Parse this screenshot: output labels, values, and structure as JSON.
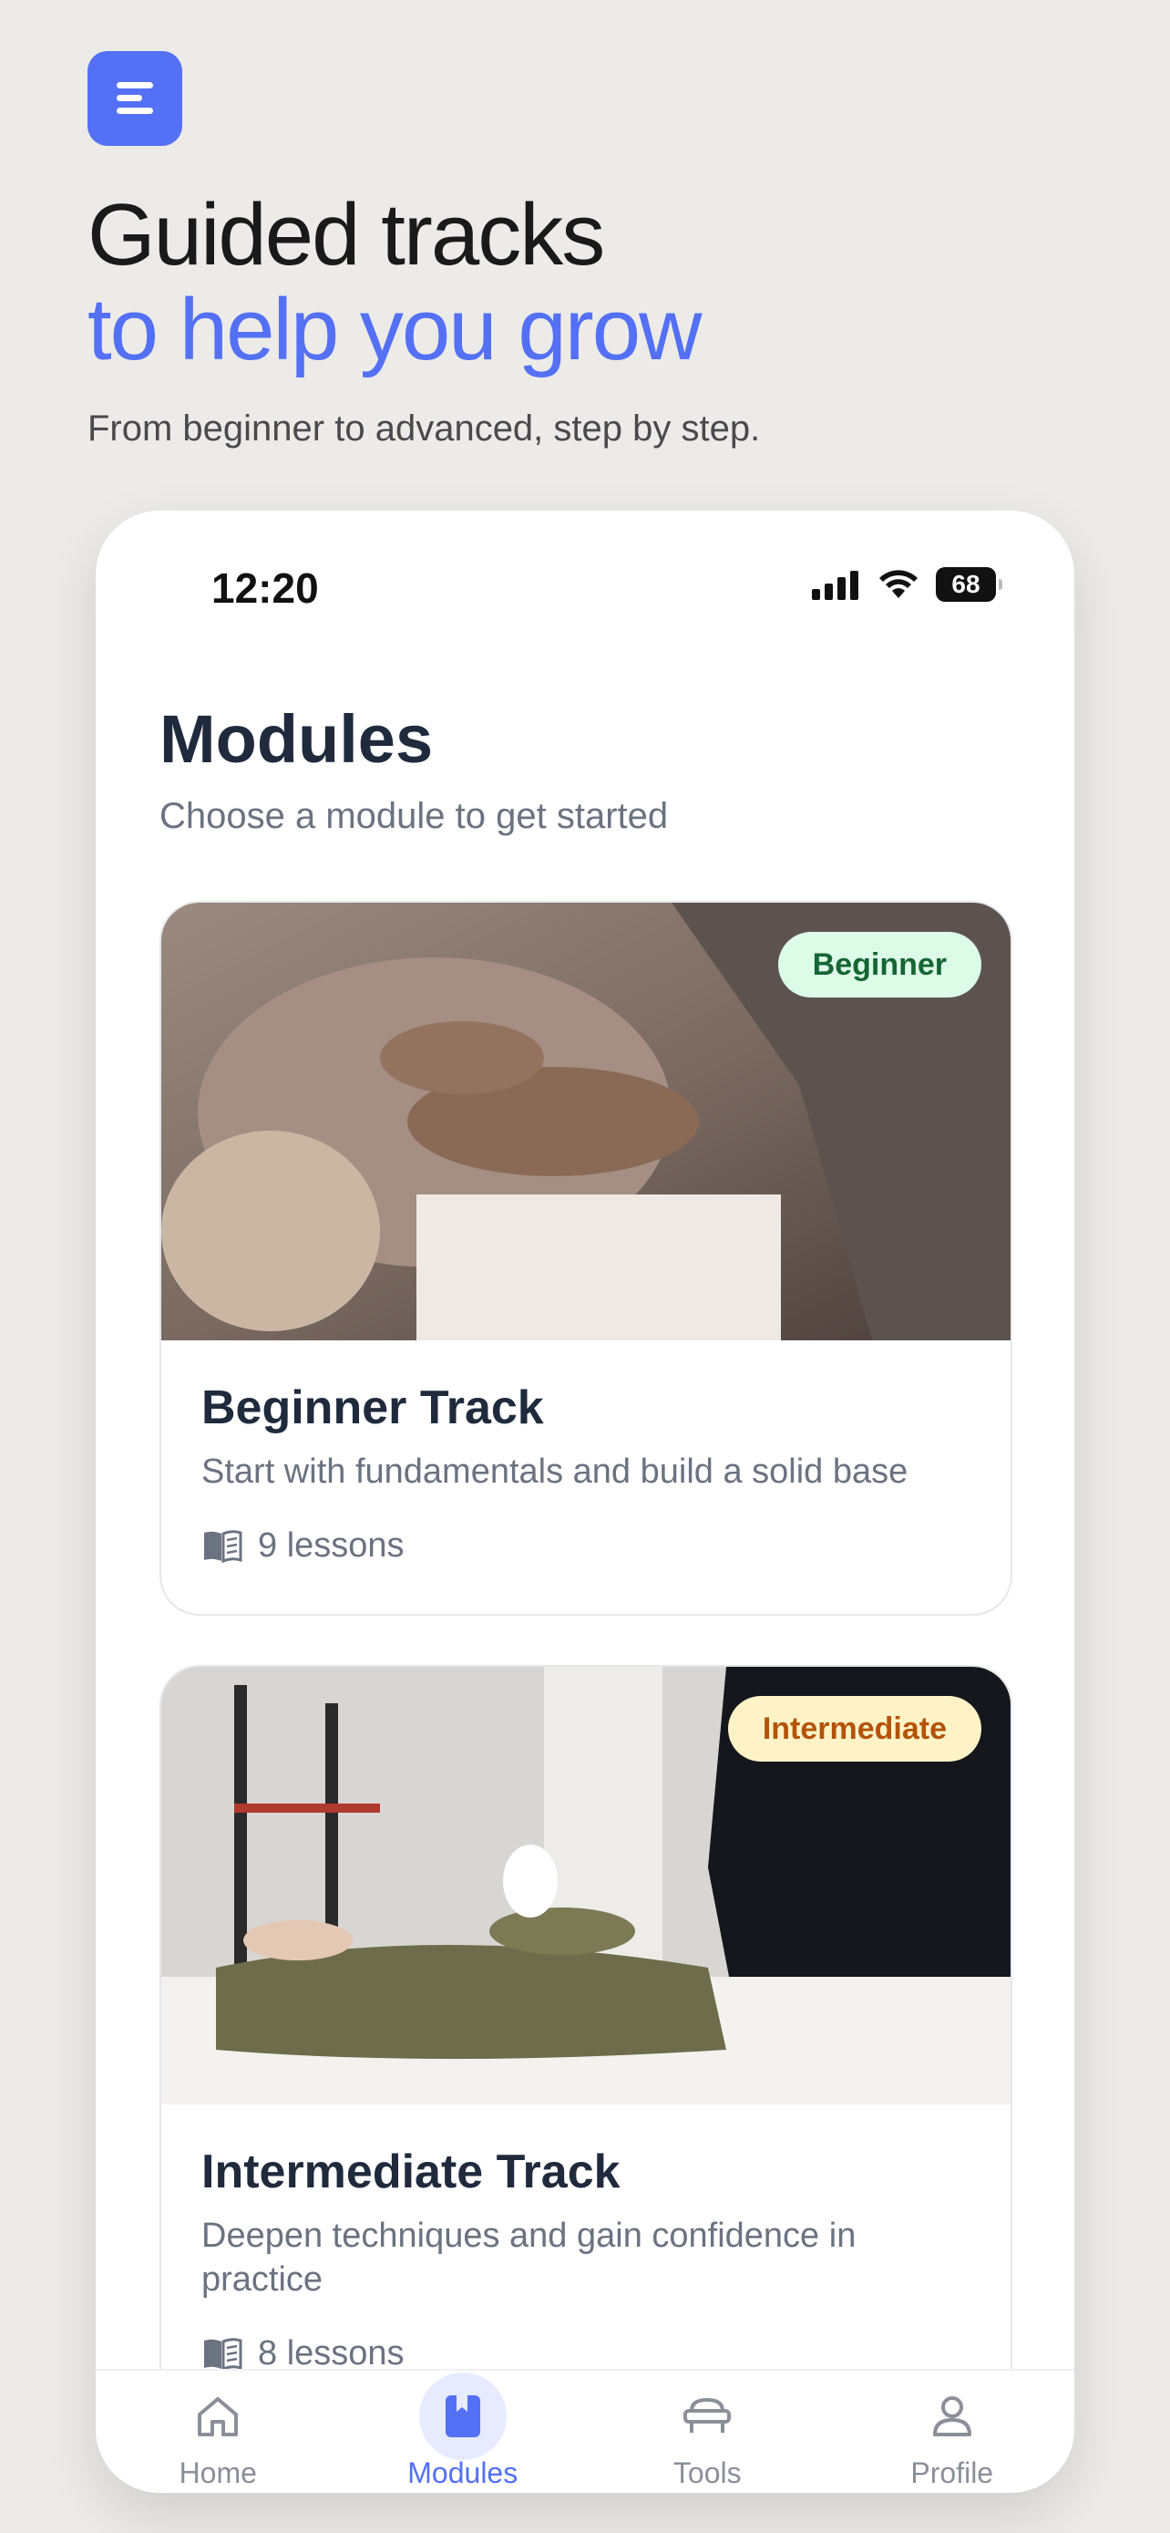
{
  "hero": {
    "title_line1": "Guided tracks",
    "title_line2": "to help you grow",
    "subtitle": "From beginner to advanced, step by step."
  },
  "status_bar": {
    "time": "12:20",
    "battery": "68"
  },
  "page": {
    "title": "Modules",
    "subtitle": "Choose a module to get started"
  },
  "modules": [
    {
      "badge": "Beginner",
      "title": "Beginner Track",
      "description": "Start with fundamentals and build a solid base",
      "lessons": "9 lessons"
    },
    {
      "badge": "Intermediate",
      "title": "Intermediate Track",
      "description": "Deepen techniques and gain confidence in practice",
      "lessons": "8 lessons"
    }
  ],
  "nav": {
    "items": [
      {
        "label": "Home",
        "icon": "home-icon"
      },
      {
        "label": "Modules",
        "icon": "book-icon",
        "active": true
      },
      {
        "label": "Tools",
        "icon": "massage-table-icon"
      },
      {
        "label": "Profile",
        "icon": "user-icon"
      }
    ]
  },
  "colors": {
    "accent": "#5470f5",
    "beginner_badge_bg": "#dcfce7",
    "beginner_badge_text": "#166534",
    "intermediate_badge_bg": "#fef3c7",
    "intermediate_badge_text": "#b45309"
  }
}
